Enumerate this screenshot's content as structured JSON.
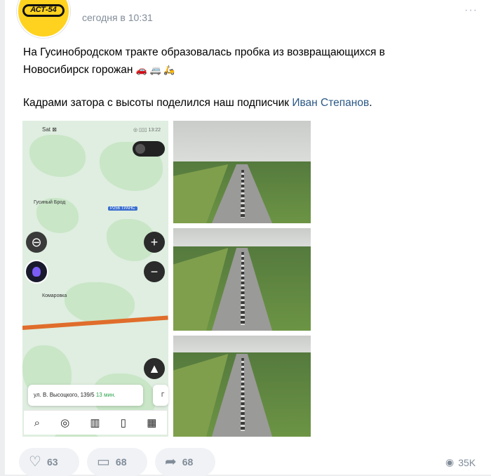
{
  "post": {
    "author": "АСТ-54",
    "time": "сегодня в 10:31",
    "menu": "···",
    "text_line1": "На Гусинобродском тракте образовалась пробка из возвращающихся в",
    "text_line2": "Новосибирск горожан",
    "emojis": "🚗 🚐 🛵",
    "text2_prefix": "Кадрами затора с высоты поделился наш подписчик",
    "mention": "Иван Степанов",
    "text2_suffix": "."
  },
  "map": {
    "status_left": "Sat ⊠",
    "status_right": "◎ ▯▯▯ 13:22",
    "place1": "Гусиный Брод",
    "place2": "Комаровка",
    "highway": "Р256 ТРАНС",
    "route_address": "ул. В. Высоцкого, 139/5",
    "route_time": "13 мин.",
    "route_side": "Г"
  },
  "actions": {
    "likes": "63",
    "comments": "68",
    "shares": "68",
    "views": "35K"
  }
}
